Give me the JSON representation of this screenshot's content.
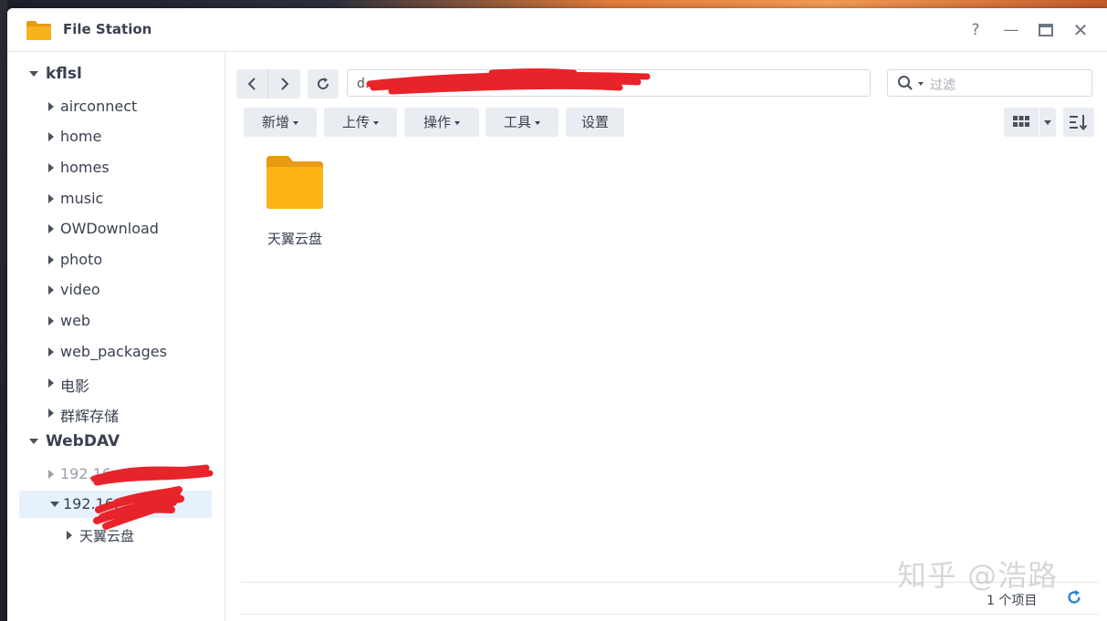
{
  "window": {
    "title": "File Station",
    "help_label": "?",
    "minimize_label": "—",
    "maximize_label": "▭",
    "close_label": "✕"
  },
  "sidebar": {
    "groups": [
      {
        "label": "kflsl",
        "items": [
          "airconnect",
          "home",
          "homes",
          "music",
          "OWDownload",
          "photo",
          "video",
          "web",
          "web_packages",
          "电影",
          "群辉存储"
        ]
      },
      {
        "label": "WebDAV",
        "items": [
          {
            "label": "192.16…  (adr",
            "state": "collapsed"
          },
          {
            "label": "192.16…  (am",
            "state": "expanded",
            "selected": true,
            "children": [
              "天翼云盘"
            ]
          }
        ]
      }
    ]
  },
  "toolbar": {
    "path_value": "d…  …  …",
    "search_placeholder": "过滤",
    "buttons": [
      {
        "label": "新增",
        "dropdown": true
      },
      {
        "label": "上传",
        "dropdown": true
      },
      {
        "label": "操作",
        "dropdown": true
      },
      {
        "label": "工具",
        "dropdown": true
      },
      {
        "label": "设置",
        "dropdown": false
      }
    ]
  },
  "files": [
    {
      "name": "天翼云盘",
      "type": "folder"
    }
  ],
  "status": {
    "count": "1 个项目"
  },
  "watermark": "知乎 @浩路",
  "colors": {
    "accent": "#2e83d6",
    "folder": "#f7b21c",
    "redaction": "#e8242b"
  }
}
